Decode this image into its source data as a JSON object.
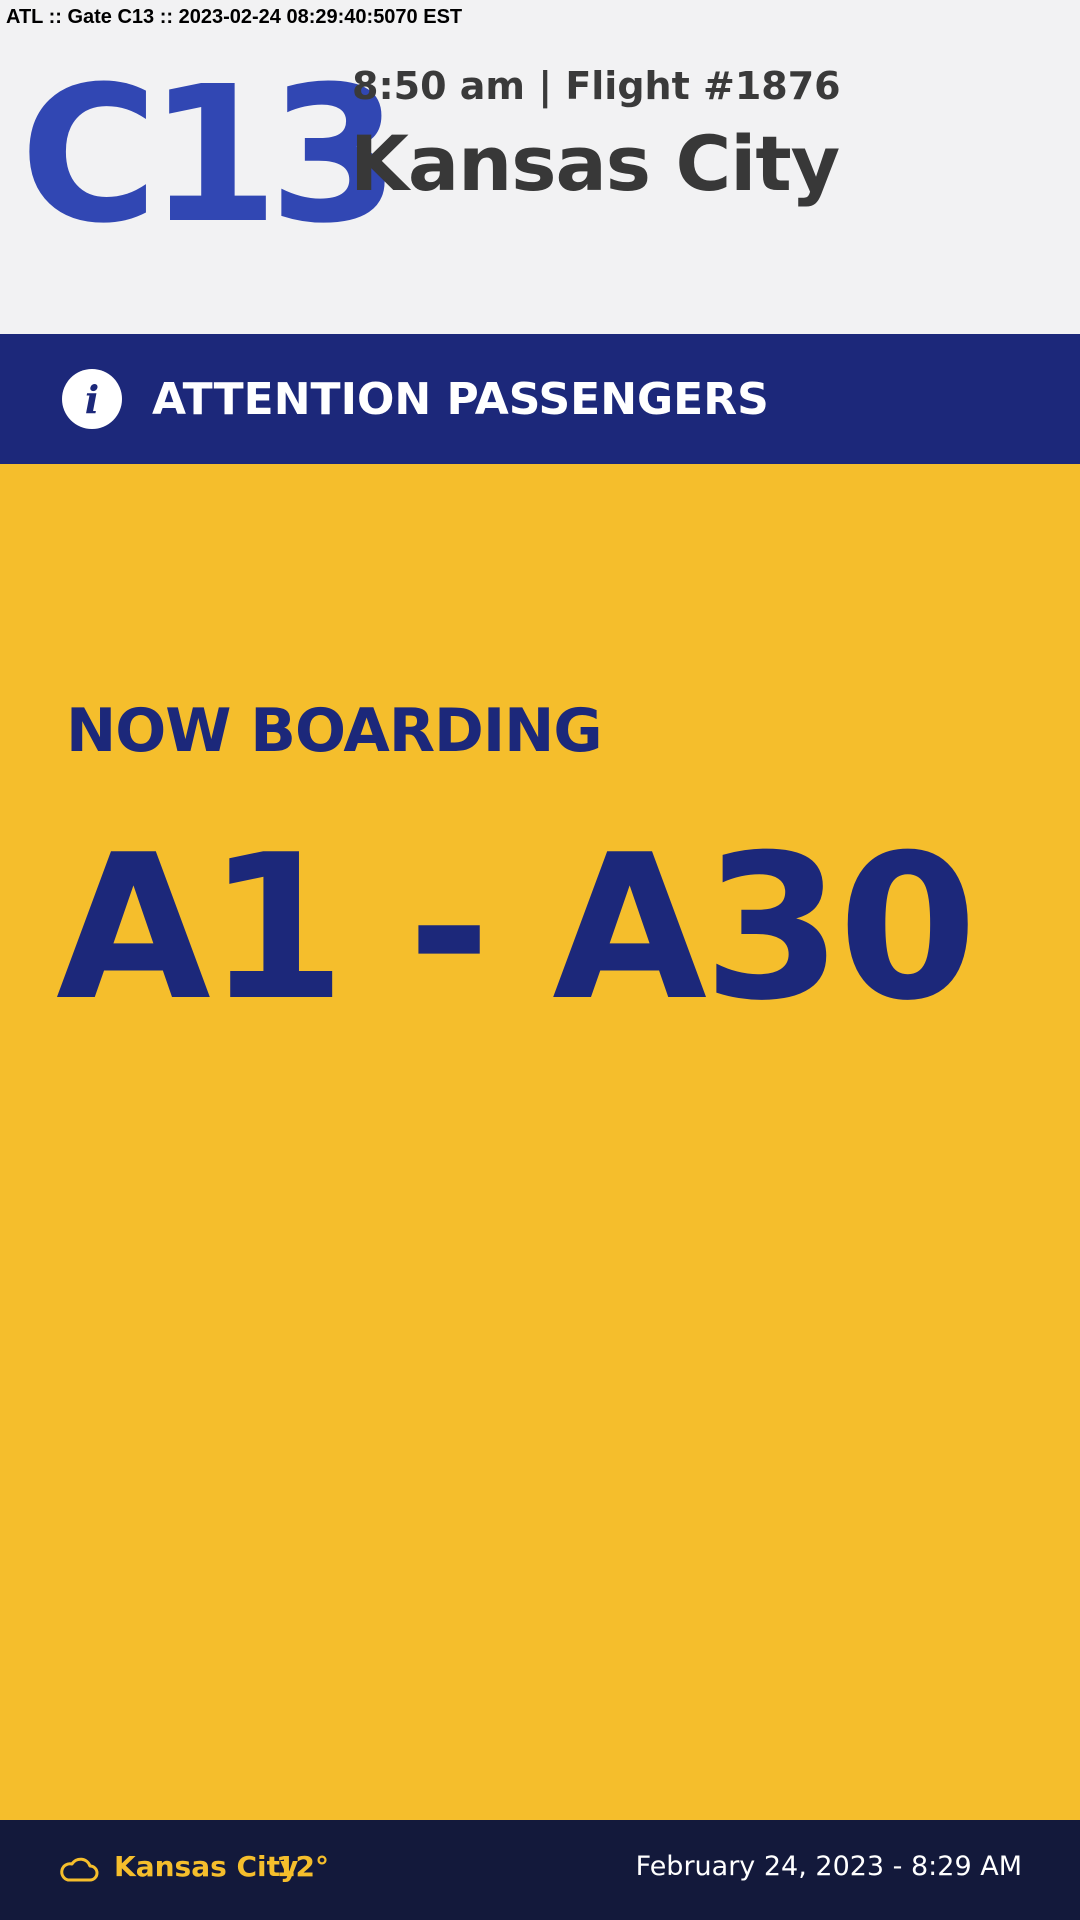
{
  "system_bar": {
    "text": "ATL :: Gate C13 :: 2023-02-24 08:29:40:5070 EST"
  },
  "header": {
    "gate": "C13",
    "flight_line": "8:50 am | Flight #1876",
    "destination": "Kansas City"
  },
  "attention": {
    "icon": "info-icon",
    "label": "ATTENTION PASSENGERS"
  },
  "notice": {
    "status": "NOW BOARDING",
    "groups": "A1 - A30"
  },
  "footer": {
    "weather_icon": "cloud-icon",
    "weather_city": "Kansas City",
    "weather_temp": "12°",
    "datetime": "February 24, 2023 - 8:29 AM"
  },
  "colors": {
    "gate_blue": "#3147b3",
    "navy": "#1c287a",
    "yellow": "#f5be2c",
    "footer_bg": "#13193b",
    "header_bg": "#f2f2f3"
  }
}
